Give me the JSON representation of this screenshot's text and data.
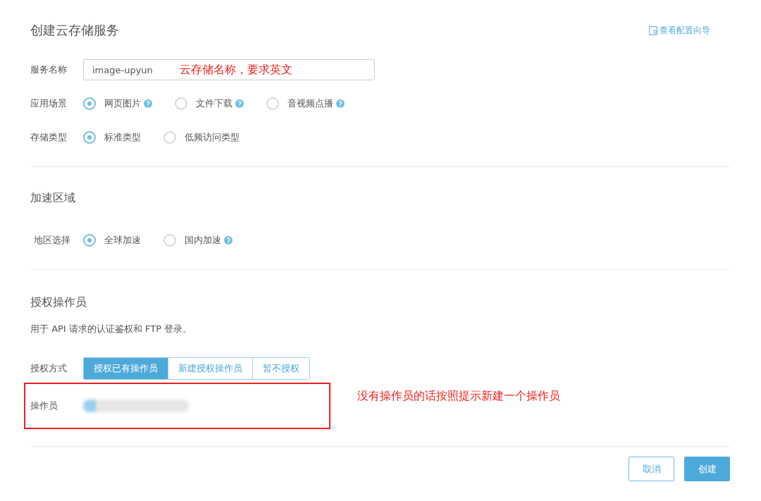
{
  "page": {
    "title": "创建云存储服务",
    "guide_link": "查看配置向导"
  },
  "service_name": {
    "label": "服务名称",
    "value": "image-upyun",
    "annotation": "云存储名称，要求英文"
  },
  "scenario": {
    "label": "应用场景",
    "options": [
      {
        "label": "网页图片",
        "selected": true,
        "help": true
      },
      {
        "label": "文件下载",
        "selected": false,
        "help": true
      },
      {
        "label": "音视频点播",
        "selected": false,
        "help": true
      }
    ]
  },
  "storage_type": {
    "label": "存储类型",
    "options": [
      {
        "label": "标准类型",
        "selected": true,
        "help": false
      },
      {
        "label": "低频访问类型",
        "selected": false,
        "help": false
      }
    ]
  },
  "acceleration": {
    "title": "加速区域",
    "label": "地区选择",
    "options": [
      {
        "label": "全球加速",
        "selected": true,
        "help": false
      },
      {
        "label": "国内加速",
        "selected": false,
        "help": true
      }
    ]
  },
  "operator_section": {
    "title": "授权操作员",
    "description": "用于 API 请求的认证鉴权和 FTP 登录。",
    "method_label": "授权方式",
    "methods": [
      {
        "label": "授权已有操作员",
        "selected": true
      },
      {
        "label": "新建授权操作员",
        "selected": false
      },
      {
        "label": "暂不授权",
        "selected": false
      }
    ],
    "operator_label": "操作员",
    "annotation": "没有操作员的话按照提示新建一个操作员"
  },
  "buttons": [
    {
      "label": "取消",
      "kind": "secondary"
    },
    {
      "label": "创建",
      "kind": "primary"
    }
  ]
}
